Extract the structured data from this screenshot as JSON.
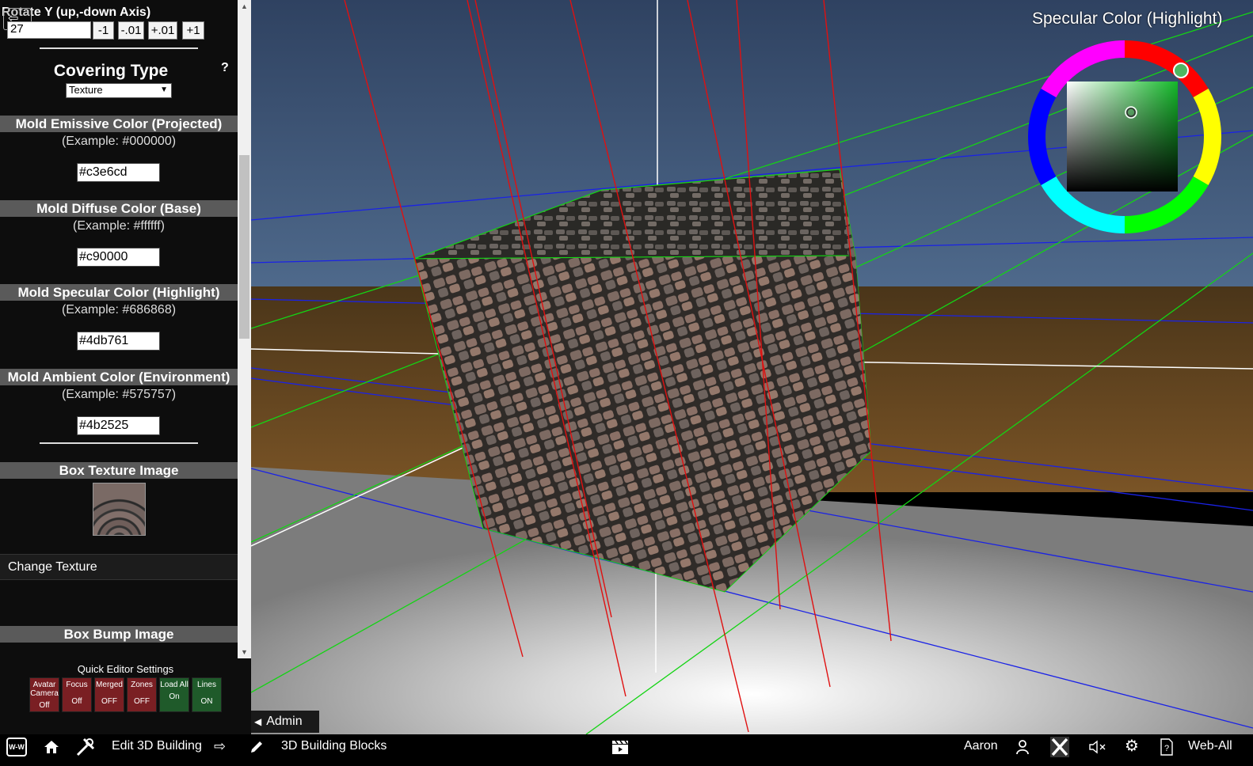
{
  "panel": {
    "rotate_label": "Rotate Y (up,-down Axis)",
    "rotate_value": "27",
    "steps": [
      "-1",
      "-.01",
      "+.01",
      "+1"
    ],
    "covering_title": "Covering Type",
    "help": "?",
    "covering_value": "Texture",
    "sections": {
      "emissive": {
        "title": "Mold Emissive Color (Projected)",
        "example": "(Example: #000000)",
        "value": "#c3e6cd"
      },
      "diffuse": {
        "title": "Mold Diffuse Color (Base)",
        "example": "(Example: #ffffff)",
        "value": "#c90000"
      },
      "specular": {
        "title": "Mold Specular Color (Highlight)",
        "example": "(Example: #686868)",
        "value": "#4db761"
      },
      "ambient": {
        "title": "Mold Ambient Color (Environment)",
        "example": "(Example: #575757)",
        "value": "#4b2525"
      }
    },
    "box_texture_title": "Box Texture Image",
    "change_texture": "Change Texture",
    "box_bump_title": "Box Bump Image"
  },
  "quick": {
    "title": "Quick Editor Settings",
    "buttons": [
      {
        "label": "Avatar Camera",
        "state": "Off",
        "color": "red"
      },
      {
        "label": "Focus",
        "state": "Off",
        "color": "red"
      },
      {
        "label": "Merged",
        "state": "OFF",
        "color": "red"
      },
      {
        "label": "Zones",
        "state": "OFF",
        "color": "red"
      },
      {
        "label": "Load All",
        "state": "On",
        "color": "green"
      },
      {
        "label": "Lines",
        "state": "ON",
        "color": "green"
      }
    ]
  },
  "viewport": {
    "specular_picker_title": "Specular Color (Highlight)",
    "admin_tab": "Admin"
  },
  "bottombar": {
    "logo": "W-W",
    "edit_building": "Edit 3D Building",
    "building_blocks": "3D Building Blocks",
    "user": "Aaron",
    "site": "Web-All"
  },
  "colors": {
    "panel_bg": "#0d0d0d",
    "section_bar": "#5a5a5a",
    "toggle_off": "#7a1f23",
    "toggle_on": "#1f5a2a",
    "sky": "#3f5677",
    "ground": "#6b4a22",
    "floor": "#9a9a9a"
  }
}
